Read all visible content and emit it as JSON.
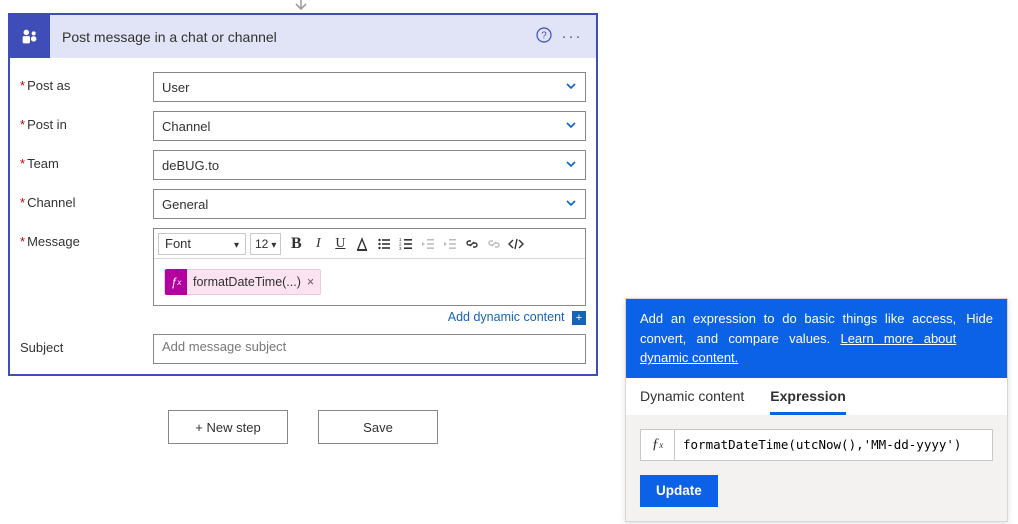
{
  "action": {
    "title": "Post message in a chat or channel",
    "icon_name": "teams-icon"
  },
  "fields": {
    "post_as": {
      "label": "Post as",
      "value": "User"
    },
    "post_in": {
      "label": "Post in",
      "value": "Channel"
    },
    "team": {
      "label": "Team",
      "value": "deBUG.to"
    },
    "channel": {
      "label": "Channel",
      "value": "General"
    },
    "message": {
      "label": "Message"
    },
    "subject": {
      "label": "Subject",
      "placeholder": "Add message subject"
    }
  },
  "editor": {
    "font_label": "Font",
    "size_label": "12",
    "token": "formatDateTime(...)",
    "add_dynamic_label": "Add dynamic content"
  },
  "buttons": {
    "new_step": "+ New step",
    "save": "Save"
  },
  "panel": {
    "banner_text": "Add an expression to do basic things like access, convert, and compare values. ",
    "learn_more": "Learn more about dynamic content.",
    "hide": "Hide",
    "tab_dynamic": "Dynamic content",
    "tab_expression": "Expression",
    "fx_value": "formatDateTime(utcNow(),'MM-dd-yyyy')",
    "update": "Update"
  }
}
